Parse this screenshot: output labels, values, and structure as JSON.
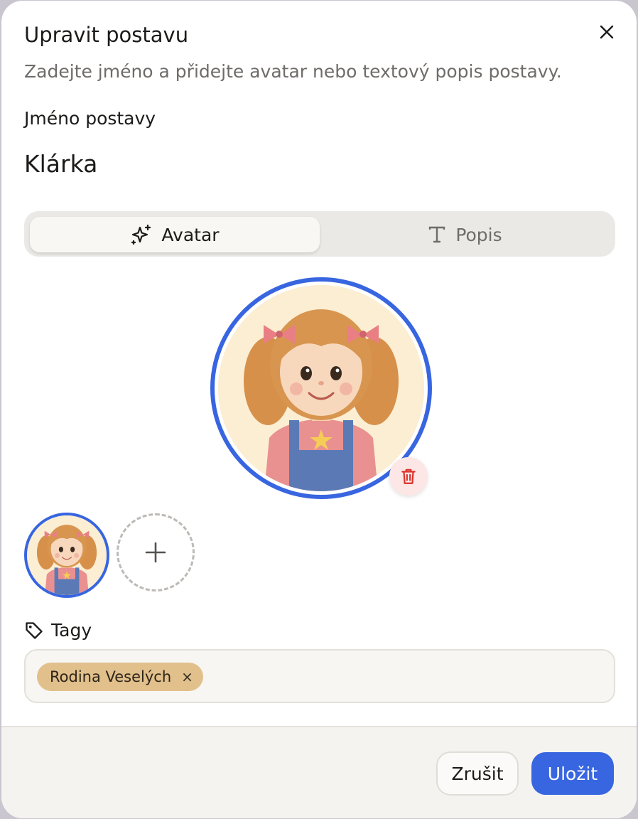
{
  "dialog": {
    "title": "Upravit postavu",
    "subtitle": "Zadejte jméno a přidejte avatar nebo textový popis postavy.",
    "close_icon": "close-icon"
  },
  "name": {
    "label": "Jméno postavy",
    "value": "Klárka"
  },
  "tabs": [
    {
      "label": "Avatar",
      "icon": "sparkles-icon",
      "active": true
    },
    {
      "label": "Popis",
      "icon": "text-icon",
      "active": false
    }
  ],
  "avatar": {
    "selected_index": 0,
    "delete_icon": "trash-icon",
    "add_icon": "plus-icon"
  },
  "tags": {
    "label": "Tagy",
    "icon": "tag-icon",
    "items": [
      {
        "label": "Rodina Veselých",
        "remove": "×"
      }
    ]
  },
  "footer": {
    "cancel_label": "Zrušit",
    "save_label": "Uložit"
  },
  "colors": {
    "accent": "#3865e0",
    "tag_chip": "#e1c08c",
    "delete": "#d9322b"
  }
}
